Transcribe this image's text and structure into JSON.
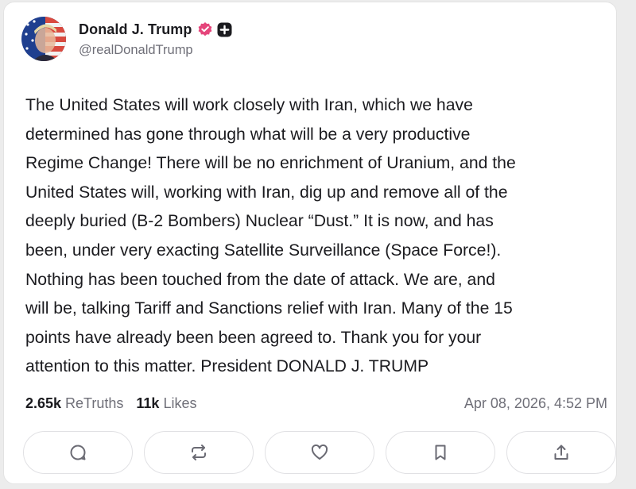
{
  "author": {
    "display_name": "Donald J. Trump",
    "handle": "@realDonaldTrump",
    "verified_color": "#e5457b",
    "badge_color": "#1b1b1f"
  },
  "post": {
    "text": "The United States will work closely with Iran, which we have\ndetermined has gone through what will be a very productive\nRegime Change! There will be no enrichment of Uranium, and the\nUnited States will, working with Iran, dig up and remove all of the\ndeeply buried (B-2 Bombers) Nuclear “Dust.” It is now, and has\nbeen, under very exacting Satellite Surveillance (Space Force!).\nNothing has been touched from the date of attack. We are, and\nwill be, talking Tariff and Sanctions relief with Iran. Many of the 15\npoints have already been been agreed to. Thank you for your\nattention to this matter. President DONALD J. TRUMP"
  },
  "stats": {
    "retruths_count": "2.65k",
    "retruths_label": "ReTruths",
    "likes_count": "11k",
    "likes_label": "Likes",
    "timestamp": "Apr 08, 2026, 4:52 PM"
  },
  "actions": [
    {
      "icon": "reply-icon"
    },
    {
      "icon": "retruth-icon"
    },
    {
      "icon": "heart-icon"
    },
    {
      "icon": "bookmark-icon"
    },
    {
      "icon": "share-icon"
    }
  ]
}
